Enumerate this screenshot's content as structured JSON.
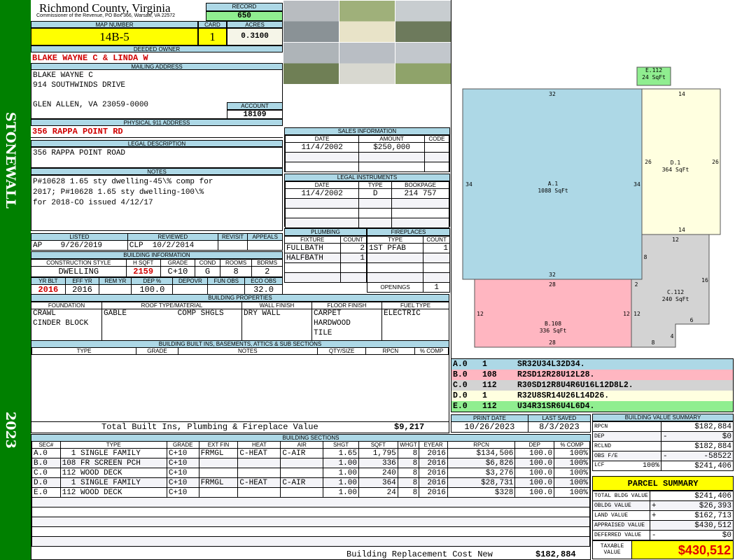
{
  "sidebar": {
    "district": "STONEWALL",
    "year": "2023"
  },
  "header": {
    "title": "Richmond County, Virginia",
    "subtitle": "Commissioner of the Revenue, PO Box 366, Warsaw, VA 22572",
    "record_label": "RECORD",
    "record": "650"
  },
  "parcel": {
    "map_label": "MAP NUMBER",
    "map": "14B-5",
    "card_label": "CARD",
    "card": "1",
    "acres_label": "ACRES",
    "acres": "0.3100"
  },
  "owner": {
    "label": "DEEDED OWNER",
    "name": "BLAKE WAYNE C & LINDA W",
    "mail_label": "MAILING ADDRESS",
    "mail": [
      "BLAKE WAYNE C",
      "914 SOUTHWINDS DRIVE",
      "",
      "GLEN ALLEN, VA 23059-0000"
    ],
    "account_label": "ACCOUNT",
    "account": "18109"
  },
  "address": {
    "label": "PHYSICAL 911 ADDRESS",
    "value": "356 RAPPA POINT RD"
  },
  "legal": {
    "label": "LEGAL DESCRIPTION",
    "value": "356 RAPPA POINT ROAD"
  },
  "notes": {
    "label": "NOTES",
    "lines": [
      "P#10628 1.65 sty dwelling-45\\% comp for",
      "2017; P#10628 1.65 sty dwelling-100\\%",
      "for 2018-CO issued 4/12/17"
    ]
  },
  "review": {
    "headers": [
      "LISTED",
      "REVIEWED",
      "REVISIT",
      "APPEALS"
    ],
    "listed_by": "AP",
    "listed": "9/26/2019",
    "reviewed_by": "CLP",
    "reviewed": "10/2/2014"
  },
  "bldg_info": {
    "title": "BUILDING INFORMATION",
    "h1": [
      "CONSTRUCTION STYLE",
      "H SQFT",
      "GRADE",
      "COND",
      "ROOMS",
      "BDRMS"
    ],
    "v1": [
      "DWELLING",
      "2159",
      "C+10",
      "G",
      "8",
      "2"
    ],
    "h2": [
      "YR BLT",
      "EFF YR",
      "REM YR",
      "DEP %",
      "DEPOVR",
      "FUN OBS",
      "ECO OBS"
    ],
    "v2": [
      "2016",
      "2016",
      "",
      "100.0",
      "",
      "",
      "32.0"
    ]
  },
  "bldg_props": {
    "title": "BUILDING PROPERTIES",
    "headers": [
      "FOUNDATION",
      "ROOF TYPE/MATERIAL",
      "WALL FINISH",
      "FLOOR FINISH",
      "FUEL TYPE"
    ],
    "foundation": [
      "CRAWL",
      "CINDER BLOCK"
    ],
    "roof_type": "GABLE",
    "roof_material": "COMP SHGLS",
    "wall": [
      "DRY WALL"
    ],
    "floor": [
      "CARPET",
      "HARDWOOD",
      "TILE"
    ],
    "fuel": [
      "ELECTRIC"
    ]
  },
  "builtins": {
    "title": "BUILDING BUILT INS, BASEMENTS, ATTICS & SUB SECTIONS",
    "headers": [
      "TYPE",
      "GRADE",
      "NOTES",
      "QTY/SIZE",
      "RPCN",
      "% COMP"
    ],
    "total_label": "Total Built Ins, Plumbing & Fireplace Value",
    "total": "$9,217"
  },
  "sections": {
    "title": "BUILDING SECTIONS",
    "headers": [
      "SEC#",
      "TYPE",
      "GRADE",
      "EXT FIN",
      "HEAT",
      "AIR",
      "SHGT",
      "SQFT",
      "WHGT",
      "EYEAR",
      "RPCN",
      "DEP",
      "% COMP"
    ],
    "rows": [
      [
        "A.0",
        "  1 SINGLE FAMILY",
        "C+10",
        "FRMGL",
        "C-HEAT",
        "C-AIR",
        "1.65",
        "1,795",
        "8",
        "2016",
        "$134,506",
        "100.0",
        "100%"
      ],
      [
        "B.0",
        "108 FR SCREEN PCH",
        "C+10",
        "",
        "",
        "",
        "1.00",
        "336",
        "8",
        "2016",
        "$6,826",
        "100.0",
        "100%"
      ],
      [
        "C.0",
        "112 WOOD DECK",
        "C+10",
        "",
        "",
        "",
        "1.00",
        "240",
        "8",
        "2016",
        "$3,276",
        "100.0",
        "100%"
      ],
      [
        "D.0",
        "  1 SINGLE FAMILY",
        "C+10",
        "FRMGL",
        "C-HEAT",
        "C-AIR",
        "1.00",
        "364",
        "8",
        "2016",
        "$28,731",
        "100.0",
        "100%"
      ],
      [
        "E.0",
        "112 WOOD DECK",
        "C+10",
        "",
        "",
        "",
        "1.00",
        "24",
        "8",
        "2016",
        "$328",
        "100.0",
        "100%"
      ]
    ],
    "total_label": "Building Replacement Cost New",
    "total": "$182,884"
  },
  "sales": {
    "title": "SALES INFORMATION",
    "headers": [
      "DATE",
      "AMOUNT",
      "CODE"
    ],
    "rows": [
      [
        "11/4/2002",
        "$250,000",
        ""
      ]
    ]
  },
  "instruments": {
    "title": "LEGAL INSTRUMENTS",
    "headers": [
      "DATE",
      "TYPE",
      "BOOKPAGE"
    ],
    "rows": [
      [
        "11/4/2002",
        "D",
        "214 757"
      ]
    ]
  },
  "plumbing": {
    "title": "PLUMBING",
    "headers": [
      "FIXTURE",
      "COUNT"
    ],
    "rows": [
      [
        "FULLBATH",
        "2"
      ],
      [
        "HALFBATH",
        "1"
      ]
    ]
  },
  "fireplaces": {
    "title": "FIREPLACES",
    "headers": [
      "TYPE",
      "COUNT"
    ],
    "rows": [
      [
        "1ST PFAB",
        "1"
      ]
    ],
    "openings_label": "OPENINGS",
    "openings": "1"
  },
  "sketch": {
    "areas": [
      {
        "id": "A.1",
        "sqft": "1088 SqFt",
        "color": "#add8e6"
      },
      {
        "id": "B.108",
        "sqft": "336 SqFt",
        "color": "#ffb6c1"
      },
      {
        "id": "C.112",
        "sqft": "240 SqFt",
        "color": "#d3d3d3"
      },
      {
        "id": "D.1",
        "sqft": "364 SqFt",
        "color": "#ffffe0"
      },
      {
        "id": "E.112",
        "sqft": "24 SqFt",
        "color": "#90ee90"
      }
    ],
    "dims": [
      "32",
      "34",
      "34",
      "32",
      "14",
      "26",
      "26",
      "14",
      "12",
      "8",
      "16",
      "2",
      "28",
      "12",
      "12",
      "12",
      "28",
      "6",
      "4",
      "8"
    ]
  },
  "codes": [
    [
      "A.0",
      "1",
      "SR32U34L32D34."
    ],
    [
      "B.0",
      "108",
      "R2SD12R28U12L28."
    ],
    [
      "C.0",
      "112",
      "R30SD12R8U4R6U16L12D8L2."
    ],
    [
      "D.0",
      "1",
      "R32U8SR14U26L14D26."
    ],
    [
      "E.0",
      "112",
      "U34R31SR6U4L6D4."
    ]
  ],
  "dates": {
    "print_label": "PRINT DATE",
    "print": "10/26/2023",
    "saved_label": "LAST SAVED",
    "saved": "8/3/2023"
  },
  "value_summary": {
    "title": "BUILDING VALUE SUMMARY",
    "rows": [
      [
        "RPCN",
        "",
        "",
        "$182,884"
      ],
      [
        "DEP",
        "",
        "-",
        "$0"
      ],
      [
        "RCLND",
        "",
        "",
        "$182,884"
      ],
      [
        "OBS F/E",
        "",
        "-",
        "-58522"
      ],
      [
        "LCF",
        "100%",
        "",
        "$241,406"
      ]
    ]
  },
  "parcel_summary": {
    "title": "PARCEL SUMMARY",
    "rows": [
      [
        "TOTAL BLDG VALUE",
        "",
        "$241,406"
      ],
      [
        "OBLDG VALUE",
        "+",
        "$26,393"
      ],
      [
        "LAND VALUE",
        "+",
        "$162,713"
      ],
      [
        "APPRAISED VALUE",
        "",
        "$430,512"
      ],
      [
        "DEFERRED VALUE",
        "-",
        "$0"
      ]
    ],
    "taxable_label": "TAXABLE VALUE",
    "taxable": "$430,512"
  }
}
